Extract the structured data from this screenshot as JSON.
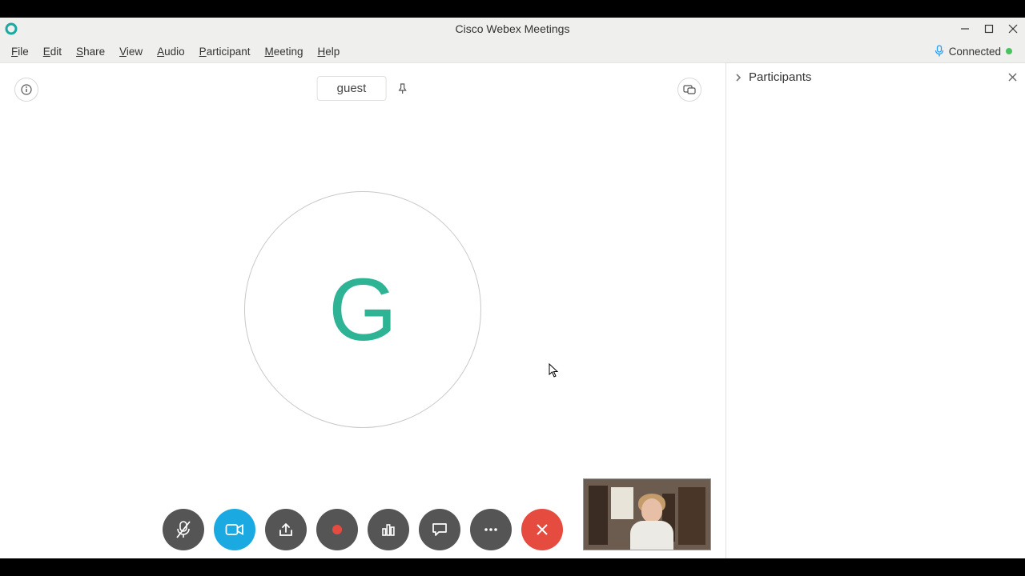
{
  "window": {
    "title": "Cisco Webex Meetings"
  },
  "menu": {
    "file": "File",
    "edit": "Edit",
    "share": "Share",
    "view": "View",
    "audio": "Audio",
    "participant": "Participant",
    "meeting": "Meeting",
    "help": "Help"
  },
  "status": {
    "connected_label": "Connected"
  },
  "main": {
    "speaker_name": "guest",
    "avatar_initial": "G"
  },
  "side_panel": {
    "title": "Participants"
  }
}
